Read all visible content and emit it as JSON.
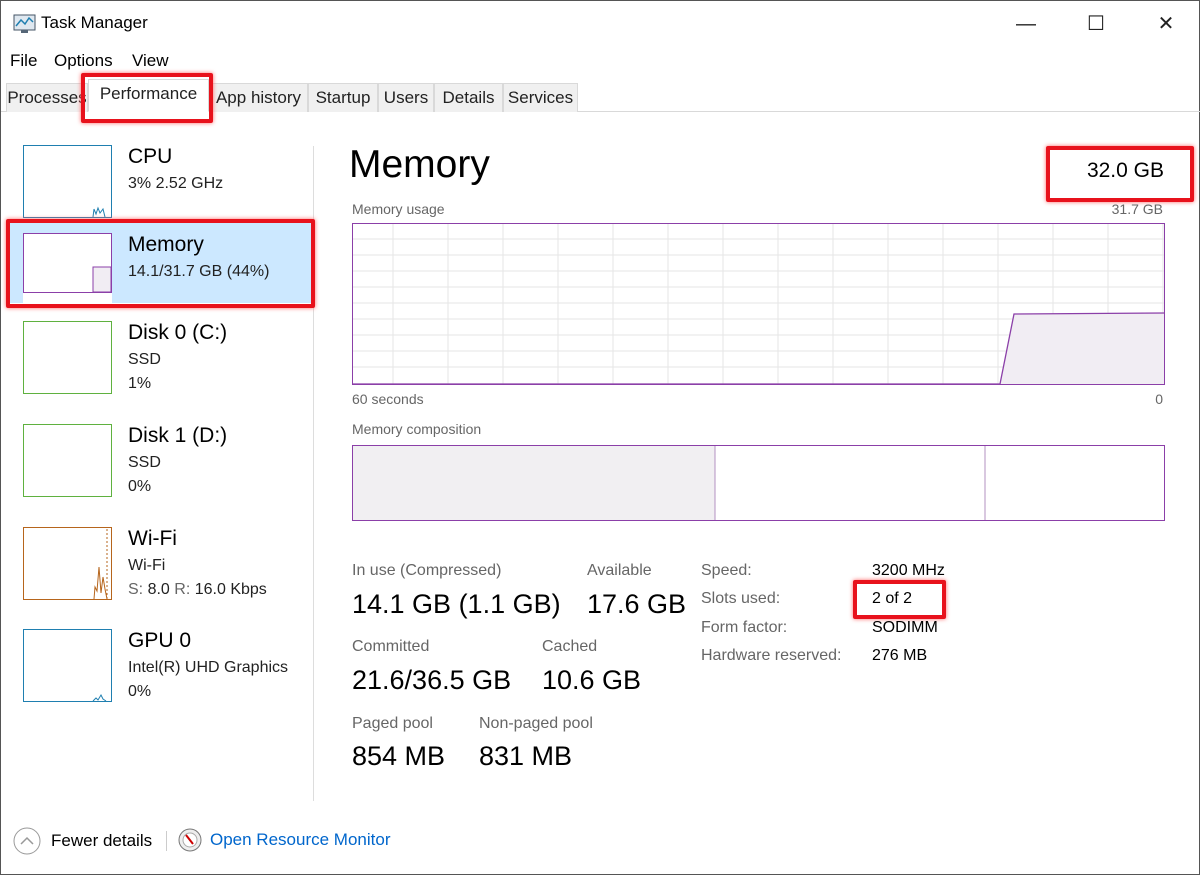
{
  "window": {
    "title": "Task Manager",
    "controls": {
      "minimize": "—",
      "maximize": "☐",
      "close": "✕"
    }
  },
  "menu": [
    "File",
    "Options",
    "View"
  ],
  "tabs": [
    {
      "label": "Processes"
    },
    {
      "label": "Performance",
      "selected": true
    },
    {
      "label": "App history"
    },
    {
      "label": "Startup"
    },
    {
      "label": "Users"
    },
    {
      "label": "Details"
    },
    {
      "label": "Services"
    }
  ],
  "sidebar": {
    "items": [
      {
        "name": "CPU",
        "sub1": "3% 2.52 GHz",
        "color": "#1f7fb0"
      },
      {
        "name": "Memory",
        "sub1": "14.1/31.7 GB (44%)",
        "color": "#8b3fa8",
        "selected": true
      },
      {
        "name": "Disk 0 (C:)",
        "sub1": "SSD",
        "sub2": "1%",
        "color": "#5fb13f"
      },
      {
        "name": "Disk 1 (D:)",
        "sub1": "SSD",
        "sub2": "0%",
        "color": "#5fb13f"
      },
      {
        "name": "Wi-Fi",
        "sub1": "Wi-Fi",
        "s_label": "S:",
        "s_val": "8.0",
        "r_label": "R:",
        "r_val": "16.0 Kbps",
        "color": "#b6651c"
      },
      {
        "name": "GPU 0",
        "sub1": "Intel(R) UHD Graphics",
        "sub2": "0%",
        "color": "#1f7fb0"
      }
    ]
  },
  "main": {
    "title": "Memory",
    "total": "32.0 GB",
    "usage_label": "Memory usage",
    "usage_max": "31.7 GB",
    "time_left": "60 seconds",
    "time_right": "0",
    "composition_label": "Memory composition",
    "stats": {
      "in_use_label": "In use (Compressed)",
      "in_use": "14.1 GB (1.1 GB)",
      "available_label": "Available",
      "available": "17.6 GB",
      "committed_label": "Committed",
      "committed": "21.6/36.5 GB",
      "cached_label": "Cached",
      "cached": "10.6 GB",
      "paged_label": "Paged pool",
      "paged": "854 MB",
      "nonpaged_label": "Non-paged pool",
      "nonpaged": "831 MB"
    },
    "details": [
      {
        "label": "Speed:",
        "value": "3200 MHz"
      },
      {
        "label": "Slots used:",
        "value": "2 of 2"
      },
      {
        "label": "Form factor:",
        "value": "SODIMM"
      },
      {
        "label": "Hardware reserved:",
        "value": "276 MB"
      }
    ]
  },
  "footer": {
    "fewer": "Fewer details",
    "monitor": "Open Resource Monitor"
  },
  "colors": {
    "memory": "#8b3fa8",
    "highlight": "#e8121c",
    "selection": "#cce8ff",
    "link": "#0066cc"
  }
}
